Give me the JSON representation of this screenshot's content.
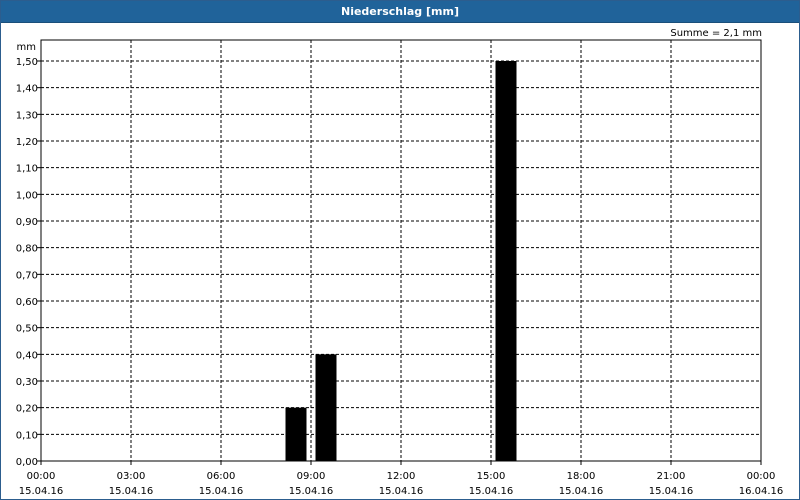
{
  "window": {
    "title": "Niederschlag [mm]"
  },
  "chart_data": {
    "type": "bar",
    "title": "Niederschlag [mm]",
    "ylabel": "mm",
    "summary": "Summe = 2,1 mm",
    "ylim": [
      0,
      1.5
    ],
    "xlim_hours": [
      0,
      24
    ],
    "y_ticks": [
      "0,00",
      "0,10",
      "0,20",
      "0,30",
      "0,40",
      "0,50",
      "0,60",
      "0,70",
      "0,80",
      "0,90",
      "1,00",
      "1,10",
      "1,20",
      "1,30",
      "1,40",
      "1,50"
    ],
    "x_ticks": [
      {
        "time": "00:00",
        "date": "15.04.16"
      },
      {
        "time": "03:00",
        "date": "15.04.16"
      },
      {
        "time": "06:00",
        "date": "15.04.16"
      },
      {
        "time": "09:00",
        "date": "15.04.16"
      },
      {
        "time": "12:00",
        "date": "15.04.16"
      },
      {
        "time": "15:00",
        "date": "15.04.16"
      },
      {
        "time": "18:00",
        "date": "15.04.16"
      },
      {
        "time": "21:00",
        "date": "15.04.16"
      },
      {
        "time": "00:00",
        "date": "16.04.16"
      }
    ],
    "bars": [
      {
        "start": "08:00",
        "end": "09:00",
        "value": 0.2
      },
      {
        "start": "09:00",
        "end": "10:00",
        "value": 0.4
      },
      {
        "start": "15:00",
        "end": "16:00",
        "value": 1.5
      }
    ],
    "bar_color": "#000000",
    "grid": true
  }
}
